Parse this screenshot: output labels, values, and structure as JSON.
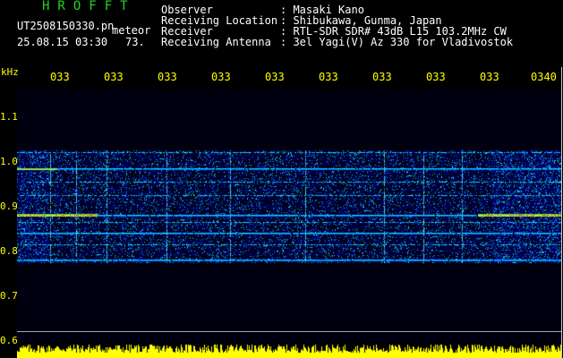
{
  "header": {
    "title": "HROFFT",
    "filename": "UT2508150330.pn",
    "filename_suffix": "meteor",
    "datetime": "25.08.15 03:30",
    "count": "73."
  },
  "info": [
    {
      "label": "Observer",
      "value": ": Masaki Kano"
    },
    {
      "label": "Receiving Location",
      "value": ": Shibukawa, Gunma, Japan"
    },
    {
      "label": "Receiver",
      "value": ": RTL-SDR SDR# 43dB L15 103.2MHz CW"
    },
    {
      "label": "Receiving Antenna",
      "value": ": 3el Yagi(V) Az 330 for Vladivostok"
    }
  ],
  "axis": {
    "y_unit": "kHz",
    "y_ticks": [
      "1.1",
      "1.0",
      "0.9",
      "0.8",
      "0.7",
      "0.6"
    ],
    "x_ticks": [
      "033",
      "033",
      "033",
      "033",
      "033",
      "033",
      "033",
      "033",
      "033",
      "0340"
    ]
  },
  "spectrogram": {
    "freq_range_khz": [
      0.6,
      1.1
    ],
    "persistent_tones_khz": [
      1.02,
      0.985,
      0.955,
      0.925,
      0.88,
      0.865,
      0.84,
      0.815,
      0.78
    ],
    "strong_tones_khz": [
      0.985,
      0.88,
      0.84,
      0.78
    ]
  },
  "colors": {
    "title": "#22d622",
    "text": "#ffffff",
    "ticks": "#ffff00",
    "signal_bar": "#ffff00",
    "background": "#000000"
  }
}
